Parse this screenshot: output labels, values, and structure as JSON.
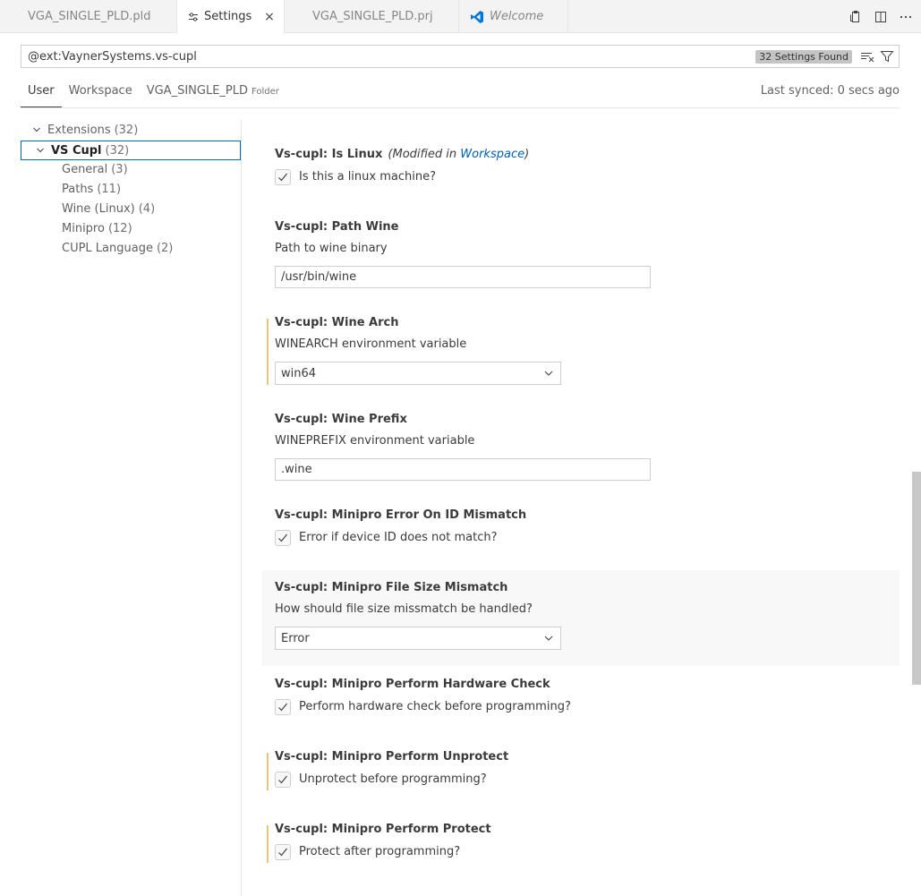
{
  "tabs": [
    {
      "label": "VGA_SINGLE_PLD.pld",
      "active": false
    },
    {
      "label": "Settings",
      "active": true,
      "close": "×"
    },
    {
      "label": "VGA_SINGLE_PLD.prj",
      "active": false
    },
    {
      "label": "Welcome",
      "active": false,
      "italic": true
    }
  ],
  "search": {
    "value": "@ext:VaynerSystems.vs-cupl",
    "found": "32 Settings Found"
  },
  "scope": {
    "user": "User",
    "workspace": "Workspace",
    "folder": "VGA_SINGLE_PLD",
    "folder_sub": "Folder",
    "synced": "Last synced: 0 secs ago"
  },
  "toc": {
    "extensions": {
      "label": "Extensions",
      "count": "(32)"
    },
    "vscupl": {
      "label": "VS Cupl",
      "count": "(32)"
    },
    "items": [
      {
        "label": "General",
        "count": "(3)"
      },
      {
        "label": "Paths",
        "count": "(11)"
      },
      {
        "label": "Wine (Linux)",
        "count": "(4)"
      },
      {
        "label": "Minipro",
        "count": "(12)"
      },
      {
        "label": "CUPL Language",
        "count": "(2)"
      }
    ]
  },
  "settings": {
    "islinux": {
      "cat": "Vs-cupl: ",
      "name": "Is Linux",
      "mod_pre": "(Modified in ",
      "mod_link": "Workspace",
      "mod_post": ")",
      "label": "Is this a linux machine?"
    },
    "pathwine": {
      "cat": "Vs-cupl: ",
      "name": "Path Wine",
      "desc": "Path to wine binary",
      "value": "/usr/bin/wine"
    },
    "winearch": {
      "cat": "Vs-cupl: ",
      "name": "Wine Arch",
      "desc": "WINEARCH environment variable",
      "value": "win64"
    },
    "wineprefix": {
      "cat": "Vs-cupl: ",
      "name": "Wine Prefix",
      "desc": "WINEPREFIX environment variable",
      "value": ".wine"
    },
    "errid": {
      "cat": "Vs-cupl: ",
      "name": "Minipro Error On ID Mismatch",
      "label": "Error if device ID does not match?"
    },
    "filesize": {
      "cat": "Vs-cupl: ",
      "name": "Minipro File Size Mismatch",
      "desc": "How should file size missmatch be handled?",
      "value": "Error"
    },
    "hwcheck": {
      "cat": "Vs-cupl: ",
      "name": "Minipro Perform Hardware Check",
      "label": "Perform hardware check before programming?"
    },
    "unprotect": {
      "cat": "Vs-cupl: ",
      "name": "Minipro Perform Unprotect",
      "label": "Unprotect before programming?"
    },
    "protect": {
      "cat": "Vs-cupl: ",
      "name": "Minipro Perform Protect",
      "label": "Protect after programming?"
    }
  },
  "colors": {
    "accent": "#005fb8",
    "modified": "#e7c67a",
    "selection_border": "#0066b8"
  }
}
